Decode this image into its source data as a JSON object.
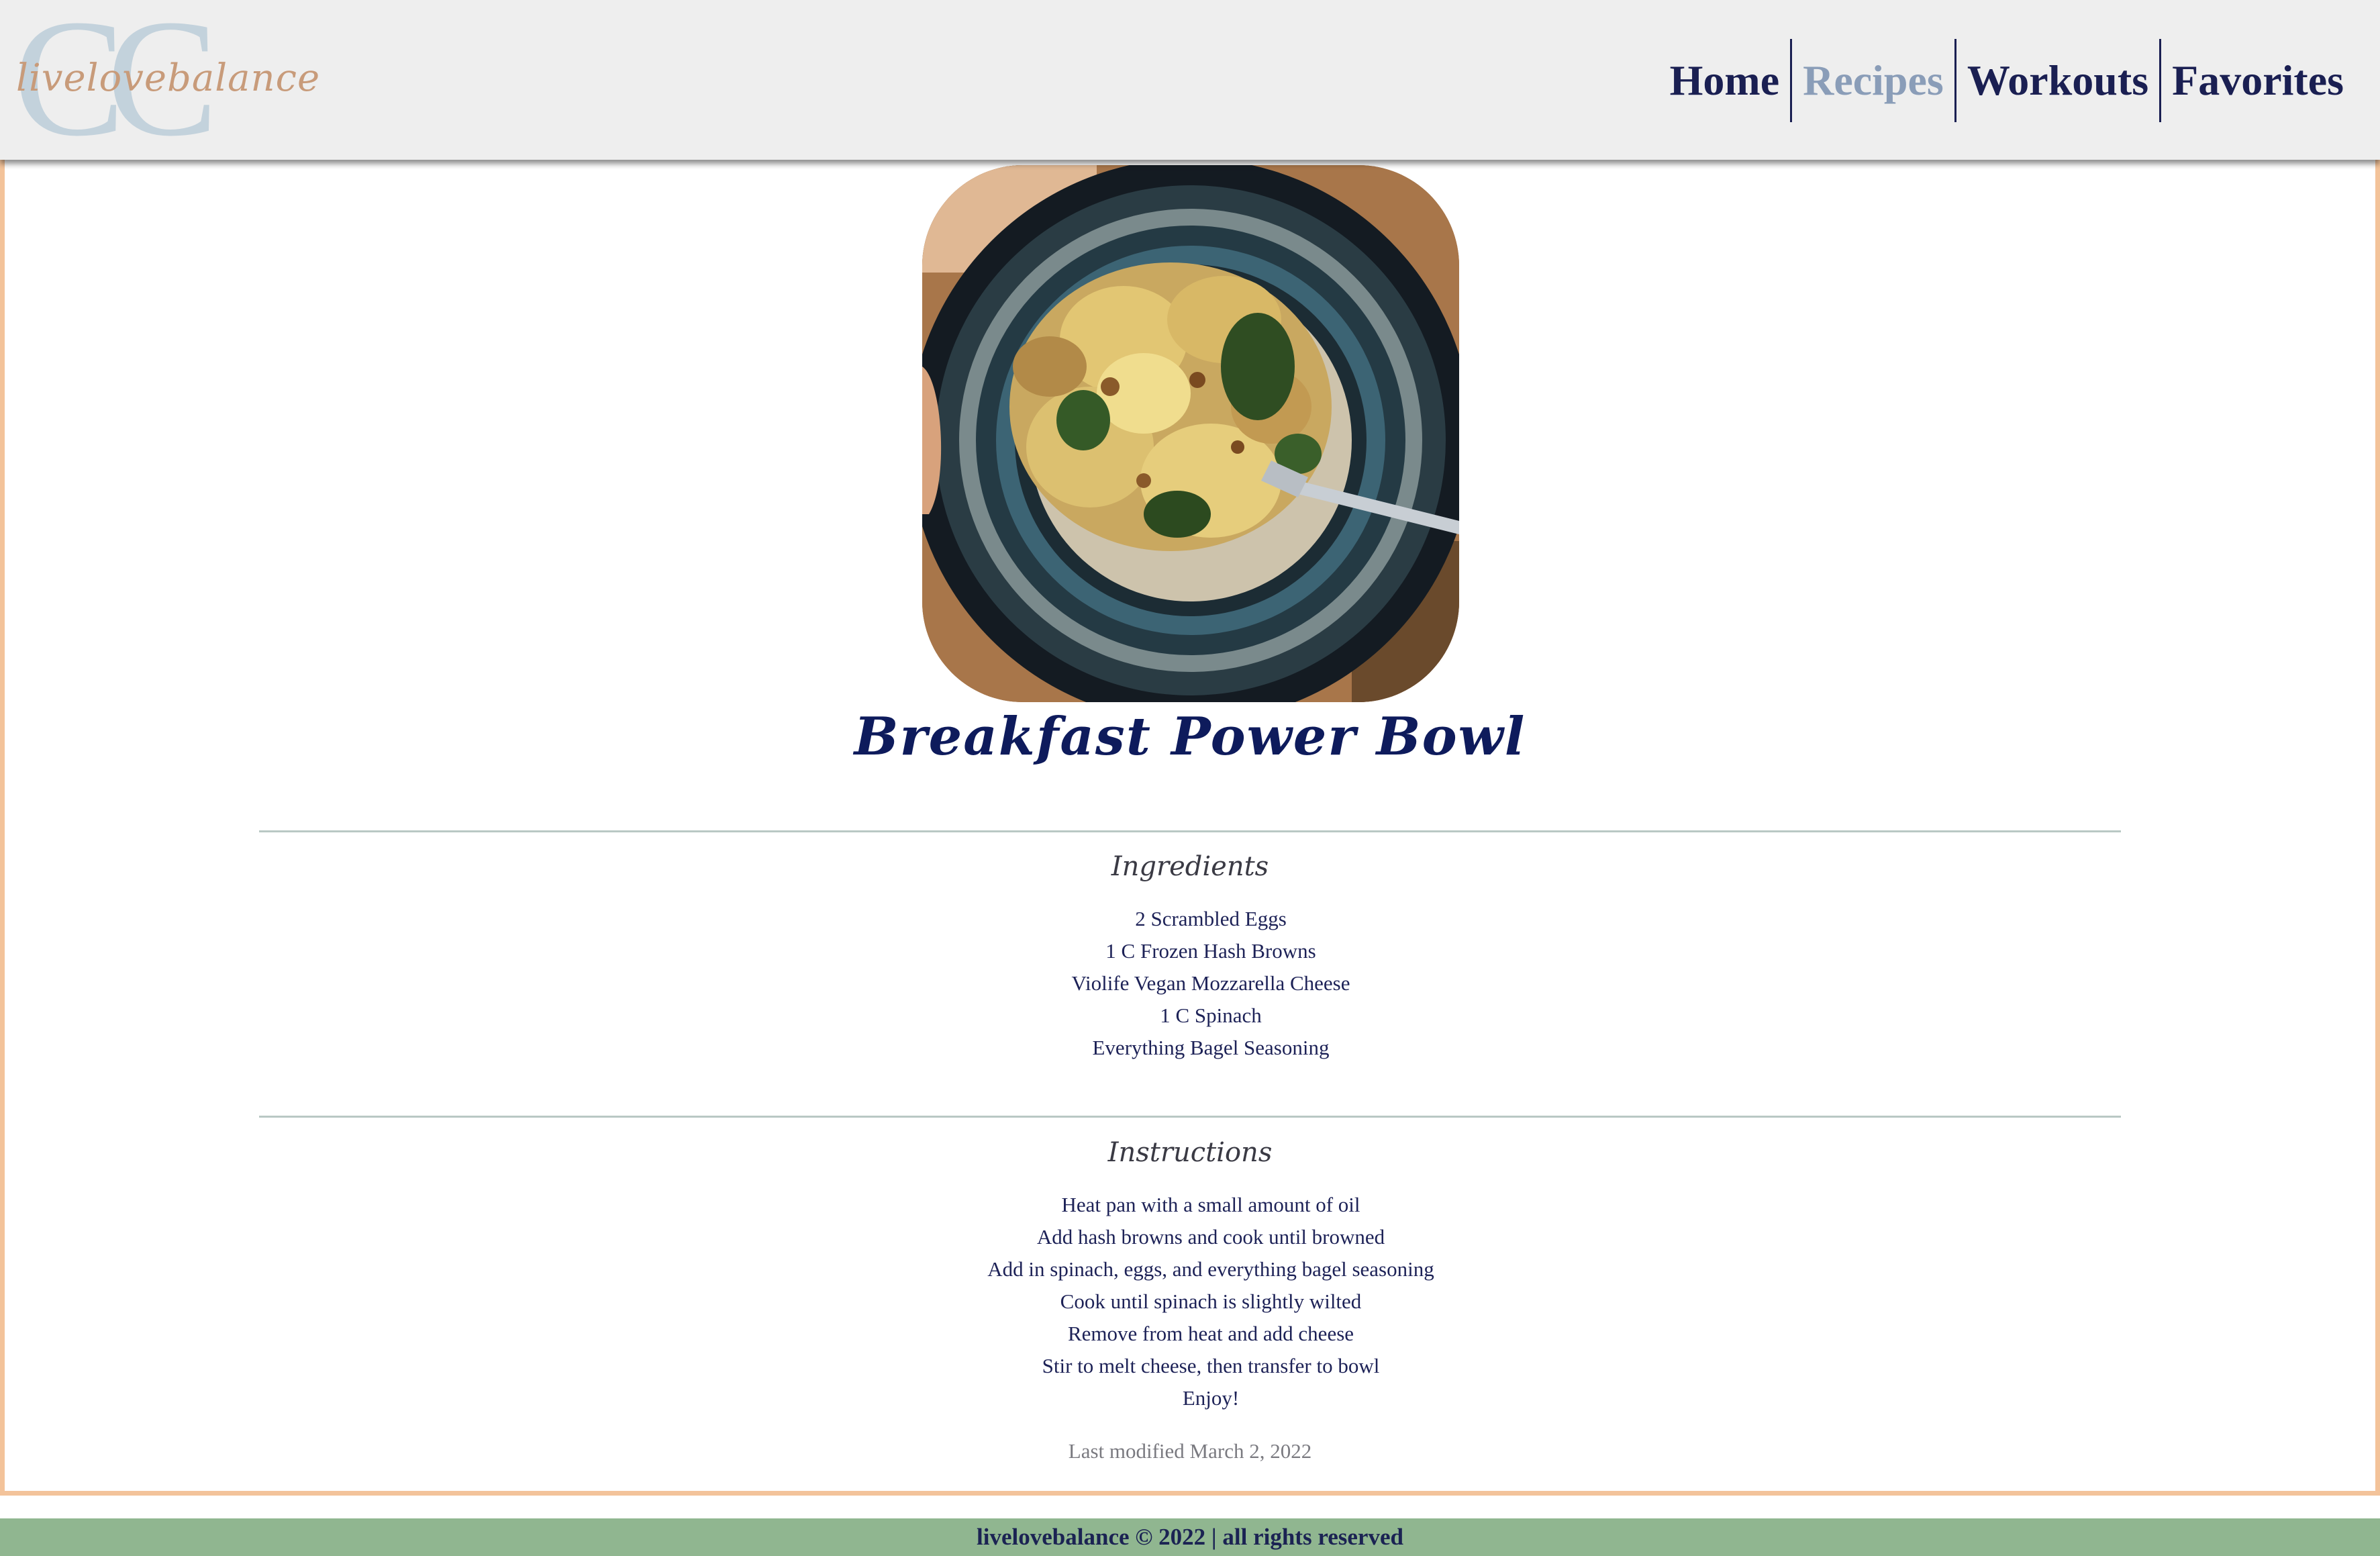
{
  "header": {
    "logo_monogram": "CC",
    "logo_text": "livelovebalance",
    "nav": [
      {
        "label": "Home",
        "active": false
      },
      {
        "label": "Recipes",
        "active": true
      },
      {
        "label": "Workouts",
        "active": false
      },
      {
        "label": "Favorites",
        "active": false
      }
    ]
  },
  "recipe": {
    "title": "Breakfast Power Bowl",
    "ingredients_heading": "Ingredients",
    "ingredients": [
      "2 Scrambled Eggs",
      "1 C Frozen Hash Browns",
      "Violife Vegan Mozzarella Cheese",
      "1 C Spinach",
      "Everything Bagel Seasoning"
    ],
    "instructions_heading": "Instructions",
    "instructions": [
      "Heat pan with a small amount of oil",
      "Add hash browns and cook until browned",
      "Add in spinach, eggs, and everything bagel seasoning",
      "Cook until spinach is slightly wilted",
      "Remove from heat and add cheese",
      "Stir to melt cheese, then transfer to bowl",
      "Enjoy!"
    ],
    "last_modified": "Last modified March 2, 2022"
  },
  "footer": {
    "text": "livelovebalance © 2022 | all rights reserved"
  },
  "colors": {
    "accent_navy": "#1a1f52",
    "active_nav": "#8a9db8",
    "frame_border": "#f3c39a",
    "footer_bg": "#90b690"
  }
}
